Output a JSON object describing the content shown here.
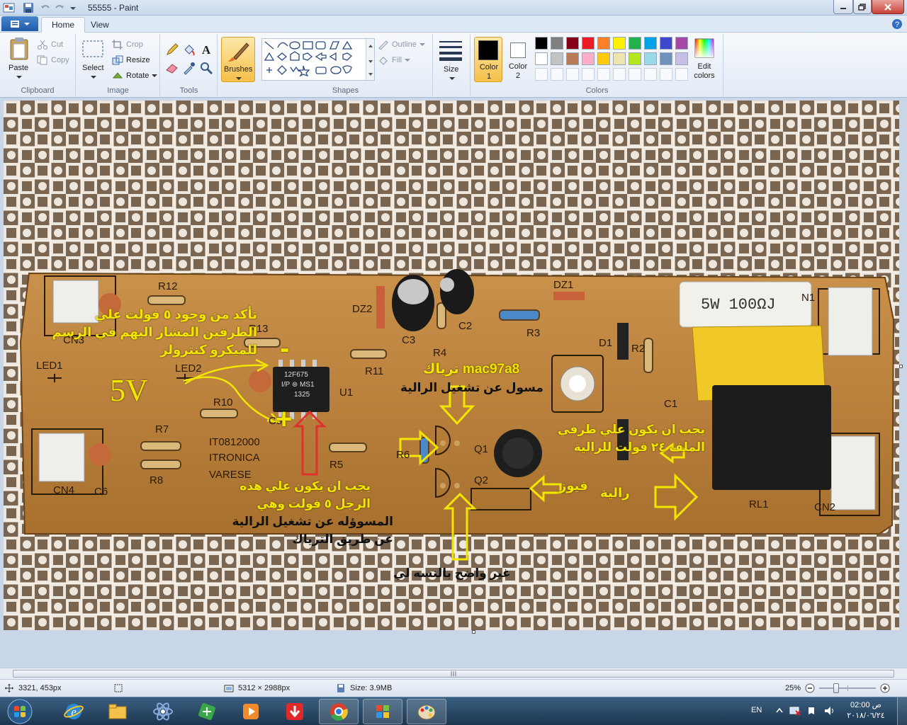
{
  "window": {
    "title": "55555 - Paint"
  },
  "tabs": [
    {
      "label": "Home"
    },
    {
      "label": "View"
    }
  ],
  "ribbon": {
    "clipboard": {
      "label": "Clipboard",
      "paste": "Paste",
      "cut": "Cut",
      "copy": "Copy"
    },
    "image": {
      "label": "Image",
      "select": "Select",
      "crop": "Crop",
      "resize": "Resize",
      "rotate": "Rotate"
    },
    "tools": {
      "label": "Tools"
    },
    "brushes": {
      "label": "Brushes"
    },
    "shapes": {
      "label": "Shapes",
      "outline": "Outline",
      "fill": "Fill"
    },
    "size": {
      "label": "Size"
    },
    "colors": {
      "label": "Colors",
      "color1": "Color\n1",
      "color2": "Color\n2",
      "edit": "Edit\ncolors",
      "color1_value": "#000000",
      "color2_value": "#ffffff",
      "palette_row1": [
        "#000000",
        "#7f7f7f",
        "#880015",
        "#ed1c24",
        "#ff7f27",
        "#fff200",
        "#22b14c",
        "#00a2e8",
        "#3f48cc",
        "#a349a4"
      ],
      "palette_row2": [
        "#ffffff",
        "#c3c3c3",
        "#b97a57",
        "#ffaec9",
        "#ffc90e",
        "#efe4b0",
        "#b5e61d",
        "#99d9ea",
        "#7092be",
        "#c8bfe7"
      ]
    }
  },
  "annotations": {
    "top_left": [
      "تأكد من وجود ٥ فولت علي",
      "الطرفين المشار اليهم في الرسم",
      "للميكرو كنترولر"
    ],
    "minus": "-",
    "plus": "+",
    "voltage": "5V",
    "triac": "mac97a8 ترياك",
    "triac_role": "مسول عن تشغيل الرالية",
    "pin_note": [
      "يجب ان يكون علي هذه",
      "الرجل ٥ فولت وهي"
    ],
    "pin_note_black": [
      "المسوؤله عن تشغيل الرالية",
      "عن طريق الترياك"
    ],
    "coil_note": [
      "يجب ان يكون علي طرفي",
      "الملف ٢٤ فولت للرالية"
    ],
    "fuse": "فيوز",
    "relay": "رالية",
    "unclear": "غير واضح بالنسه لي"
  },
  "pcb_labels": {
    "r12": "R12",
    "cn3": "CN3",
    "r13": "R13",
    "led1": "LED1",
    "led2": "LED2",
    "r10": "R10",
    "c5": "C5",
    "u1": "U1",
    "r11": "R11",
    "dz2": "DZ2",
    "c3": "C3",
    "r4": "R4",
    "c2": "C2",
    "dz1": "DZ1",
    "r3": "R3",
    "d1": "D1",
    "r2": "R2",
    "c1": "C1",
    "cn1": "N1",
    "r7": "R7",
    "r8": "R8",
    "cn4": "CN4",
    "c6": "C6",
    "board1": "IT0812000",
    "board2": "ITRONICA",
    "board3": "VARESE",
    "r5": "R5",
    "r6": "R6",
    "q1": "Q1",
    "q2": "Q2",
    "rl1": "RL1",
    "cn2": "CN2",
    "resistor_sw": "5W 100ΩJ",
    "chip_top": "12F675",
    "chip_mid": "I/P ⊛ MS1",
    "chip_bot": "1325"
  },
  "status": {
    "cursor": "3321, 453px",
    "dimensions": "5312 × 2988px",
    "size": "Size: 3.9MB",
    "zoom": "25%"
  },
  "tray": {
    "lang": "EN",
    "time": "02:00 ص",
    "date": "٢٠١٨/٠٦/٢٤"
  }
}
